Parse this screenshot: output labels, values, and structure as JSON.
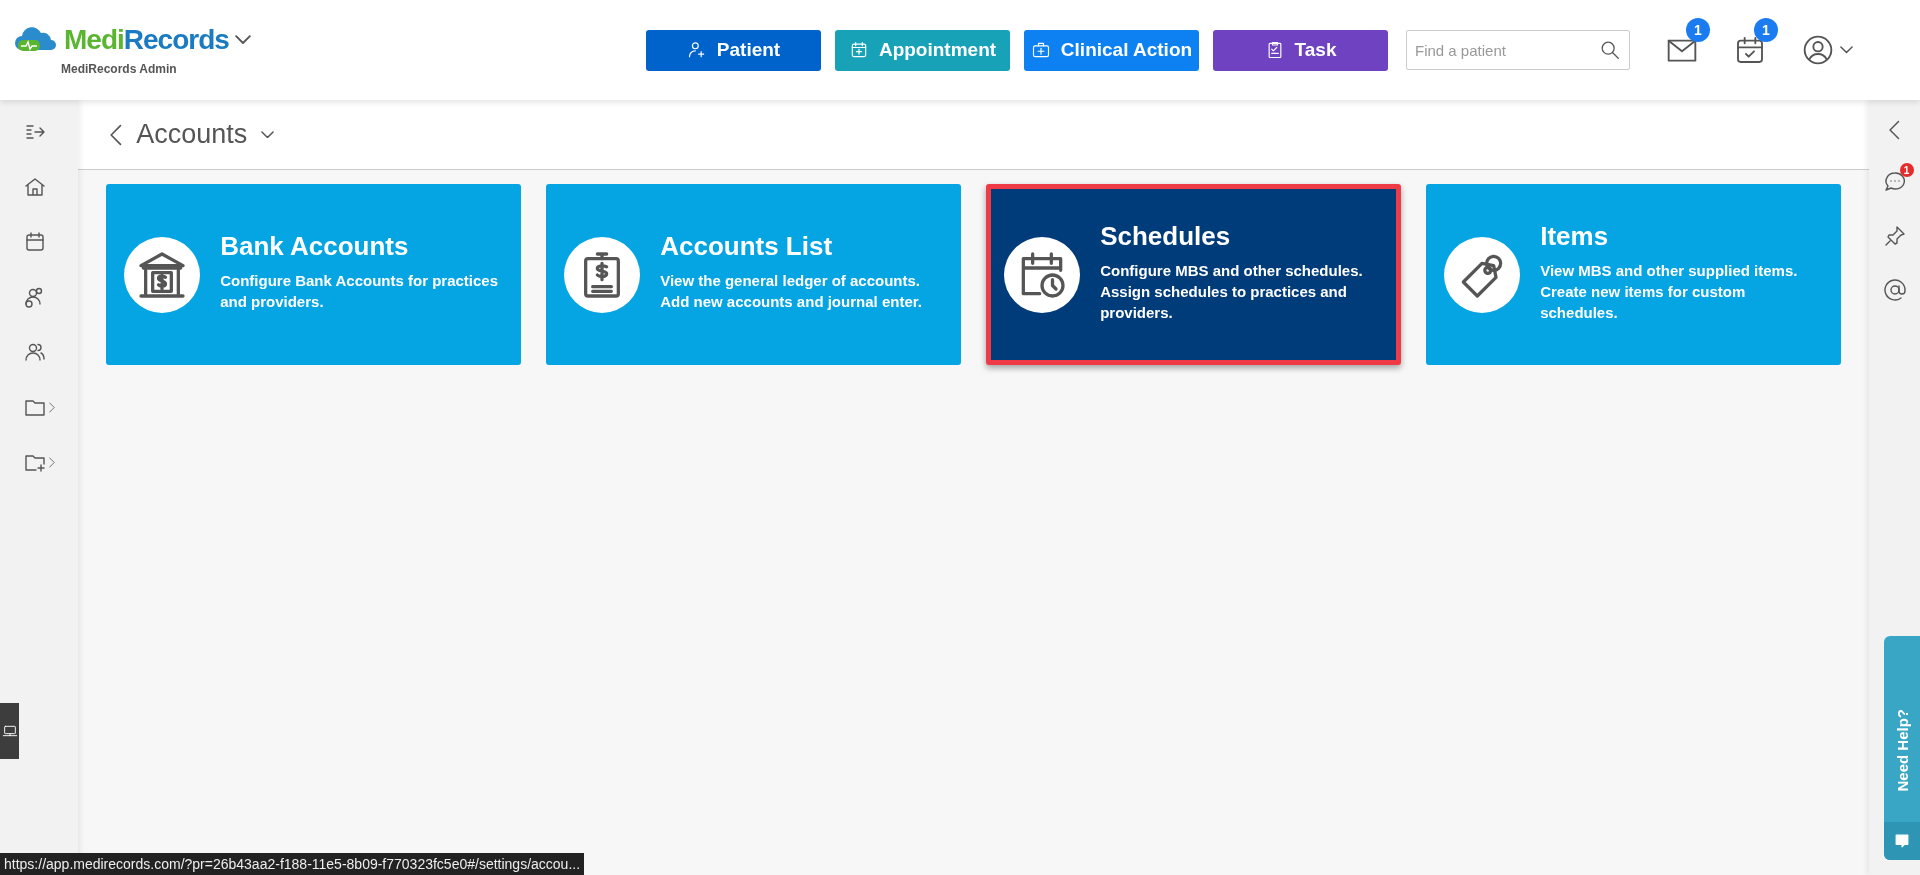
{
  "header": {
    "logo": {
      "name_parts": [
        "Medi",
        "Records"
      ],
      "subtitle": "MediRecords Admin"
    },
    "quick_actions": [
      {
        "label": "Patient",
        "color": "#0063cc"
      },
      {
        "label": "Appointment",
        "color": "#17a2b8"
      },
      {
        "label": "Clinical Action",
        "color": "#0d80f2"
      },
      {
        "label": "Task",
        "color": "#6f42c1"
      }
    ],
    "search": {
      "placeholder": "Find a patient"
    },
    "notifications": [
      {
        "badge": "1"
      },
      {
        "badge": "1"
      }
    ]
  },
  "sidebar": {
    "items": [
      {
        "expandable": false
      },
      {
        "expandable": false
      },
      {
        "expandable": false
      },
      {
        "expandable": false
      },
      {
        "expandable": true
      },
      {
        "expandable": true
      }
    ]
  },
  "breadcrumb": {
    "title": "Accounts"
  },
  "cards": [
    {
      "title": "Bank Accounts",
      "description": "Configure Bank Accounts for practices and providers.",
      "selected": false
    },
    {
      "title": "Accounts List",
      "description": "View the general ledger of accounts. Add new accounts and journal enter.",
      "selected": false
    },
    {
      "title": "Schedules",
      "description": "Configure MBS and other schedules. Assign schedules to practices and providers.",
      "selected": true
    },
    {
      "title": "Items",
      "description": "View MBS and other supplied items. Create new items for custom schedules.",
      "selected": false
    }
  ],
  "right_panel": {
    "chat_badge": "1",
    "help_label": "Need Help?"
  },
  "status_bar": {
    "url": "https://app.medirecords.com/?pr=26b43aa2-f188-11e5-8b09-f770323fc5e0#/settings/accou..."
  }
}
